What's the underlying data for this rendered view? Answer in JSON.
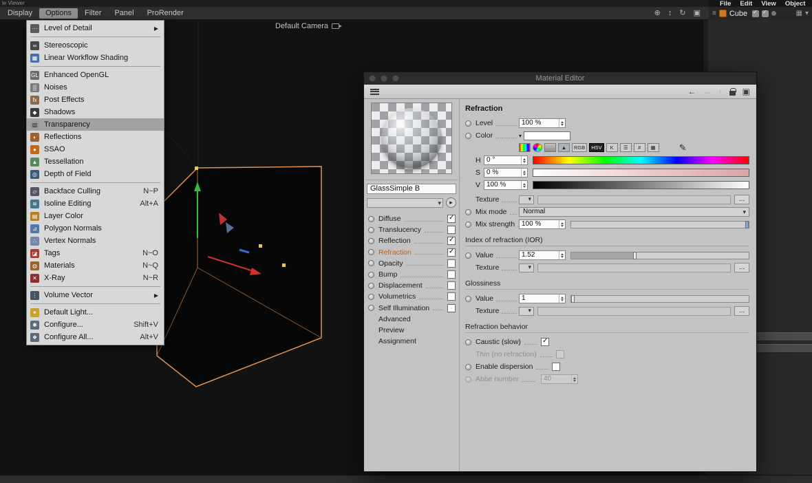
{
  "window": {
    "title_fragment": "le Viewer"
  },
  "top_right_menubar": {
    "items": [
      "File",
      "Edit",
      "View",
      "Object"
    ]
  },
  "viewport_menubar": {
    "items": [
      {
        "label": "Display"
      },
      {
        "label": "Options",
        "active": true
      },
      {
        "label": "Filter"
      },
      {
        "label": "Panel"
      },
      {
        "label": "ProRender"
      }
    ],
    "nav_icons": [
      {
        "name": "pan-icon",
        "glyph": "⊕"
      },
      {
        "name": "dolly-icon",
        "glyph": "↕"
      },
      {
        "name": "rotate-icon",
        "glyph": "↻"
      },
      {
        "name": "toggle-view-icon",
        "glyph": "▣"
      }
    ]
  },
  "viewport": {
    "camera_label": "Default Camera"
  },
  "object_manager": {
    "object_name": "Cube"
  },
  "options_menu": {
    "items": [
      {
        "label": "Level of Detail",
        "icon": "level-of-detail",
        "submenu": true
      },
      {
        "separator": true
      },
      {
        "label": "Stereoscopic",
        "icon": "stereoscopic"
      },
      {
        "label": "Linear Workflow Shading",
        "icon": "linear-workflow"
      },
      {
        "separator": true
      },
      {
        "label": "Enhanced OpenGL",
        "icon": "enhanced-opengl"
      },
      {
        "label": "Noises",
        "icon": "noises"
      },
      {
        "label": "Post Effects",
        "icon": "post-effects"
      },
      {
        "label": "Shadows",
        "icon": "shadows"
      },
      {
        "label": "Transparency",
        "icon": "transparency",
        "highlighted": true
      },
      {
        "label": "Reflections",
        "icon": "reflections"
      },
      {
        "label": "SSAO",
        "icon": "ssao"
      },
      {
        "label": "Tessellation",
        "icon": "tessellation"
      },
      {
        "label": "Depth of Field",
        "icon": "depth-of-field"
      },
      {
        "separator": true
      },
      {
        "label": "Backface Culling",
        "icon": "backface-culling",
        "shortcut": "N~P"
      },
      {
        "label": "Isoline Editing",
        "icon": "isoline-editing",
        "shortcut": "Alt+A"
      },
      {
        "label": "Layer Color",
        "icon": "layer-color"
      },
      {
        "label": "Polygon Normals",
        "icon": "polygon-normals"
      },
      {
        "label": "Vertex Normals",
        "icon": "vertex-normals"
      },
      {
        "label": "Tags",
        "icon": "tags",
        "shortcut": "N~O"
      },
      {
        "label": "Materials",
        "icon": "materials",
        "shortcut": "N~Q"
      },
      {
        "label": "X-Ray",
        "icon": "x-ray",
        "shortcut": "N~R"
      },
      {
        "separator": true
      },
      {
        "label": "Volume Vector",
        "icon": "volume-vector",
        "submenu": true
      },
      {
        "separator": true
      },
      {
        "label": "Default Light...",
        "icon": "default-light"
      },
      {
        "label": "Configure...",
        "icon": "configure",
        "shortcut": "Shift+V"
      },
      {
        "label": "Configure All...",
        "icon": "configure-all",
        "shortcut": "Alt+V"
      }
    ]
  },
  "icon_glyphs": {
    "level-of-detail": {
      "bg": "#5a5a5a",
      "glyph": "⋯"
    },
    "stereoscopic": {
      "bg": "#474747",
      "glyph": "∞"
    },
    "linear-workflow": {
      "bg": "#4a6fa5",
      "glyph": "▦"
    },
    "enhanced-opengl": {
      "bg": "#6a6a6a",
      "glyph": "GL"
    },
    "noises": {
      "bg": "#7a7a7a",
      "glyph": "▒"
    },
    "post-effects": {
      "bg": "#8a6a4a",
      "glyph": "fx"
    },
    "shadows": {
      "bg": "#3a3a3a",
      "glyph": "◆"
    },
    "transparency": {
      "bg": "#9a9a9a",
      "glyph": "▨",
      "fg": "#2a2a2a"
    },
    "reflections": {
      "bg": "#a06030",
      "glyph": "◐"
    },
    "ssao": {
      "bg": "#c06818",
      "glyph": "●"
    },
    "tessellation": {
      "bg": "#5a8a5a",
      "glyph": "▲"
    },
    "depth-of-field": {
      "bg": "#3a5a7a",
      "glyph": "◎"
    },
    "backface-culling": {
      "bg": "#555566",
      "glyph": "▱"
    },
    "isoline-editing": {
      "bg": "#46748c",
      "glyph": "≋"
    },
    "layer-color": {
      "bg": "#b08030",
      "glyph": "▤"
    },
    "polygon-normals": {
      "bg": "#5578aa",
      "glyph": "⊿"
    },
    "vertex-normals": {
      "bg": "#7788aa",
      "glyph": "∴"
    },
    "tags": {
      "bg": "#a04030",
      "glyph": "◪"
    },
    "materials": {
      "bg": "#96642c",
      "glyph": "◍"
    },
    "x-ray": {
      "bg": "#883030",
      "glyph": "✕"
    },
    "volume-vector": {
      "bg": "#445566",
      "glyph": "⋮"
    },
    "default-light": {
      "bg": "#c8a030",
      "glyph": "✶"
    },
    "configure": {
      "bg": "#5a6a7a",
      "glyph": "✱"
    },
    "configure-all": {
      "bg": "#5a6a7a",
      "glyph": "❖"
    },
    "eyedropper": {
      "glyph": "✎"
    }
  },
  "material_editor": {
    "title": "Material Editor",
    "toolbar": {
      "back_glyph": "←",
      "forward_glyph": "→",
      "up_glyph": "↑"
    },
    "material_name": "GlassSimple B",
    "channels": [
      {
        "label": "Diffuse",
        "checked": true
      },
      {
        "label": "Translucency",
        "checked": false
      },
      {
        "label": "Reflection",
        "checked": true
      },
      {
        "label": "Refraction",
        "checked": true,
        "active": true
      },
      {
        "label": "Opacity",
        "checked": false
      },
      {
        "label": "Bump",
        "checked": false
      },
      {
        "label": "Displacement",
        "checked": false
      },
      {
        "label": "Volumetrics",
        "checked": false
      },
      {
        "label": "Self Illumination",
        "checked": false
      }
    ],
    "pages": [
      "Advanced",
      "Preview",
      "Assignment"
    ],
    "refraction": {
      "heading": "Refraction",
      "level_label": "Level",
      "level_value": "100 %",
      "color_label": "Color",
      "picker_chips": [
        {
          "name": "spectrum-icon"
        },
        {
          "name": "color-wheel-icon"
        },
        {
          "name": "grayscale-icon"
        },
        {
          "name": "image-icon",
          "glyph": "▲"
        },
        {
          "name": "rgb-mode",
          "label": "RGB"
        },
        {
          "name": "hsv-mode",
          "label": "HSV",
          "active": true
        },
        {
          "name": "kelvin-mode",
          "label": "K"
        },
        {
          "name": "mixer-icon",
          "glyph": "☰"
        },
        {
          "name": "numeric-icon",
          "glyph": "#"
        },
        {
          "name": "table-icon",
          "glyph": "▦"
        }
      ],
      "h_label": "H",
      "h_value": "0 °",
      "s_label": "S",
      "s_value": "0 %",
      "v_label": "V",
      "v_value": "100 %",
      "texture_label": "Texture",
      "texture_button": "...",
      "mix_mode_label": "Mix mode",
      "mix_mode_value": "Normal",
      "mix_strength_label": "Mix strength",
      "mix_strength_value": "100 %",
      "ior_heading": "Index of refraction (IOR)",
      "ior_value_label": "Value",
      "ior_value": "1.52",
      "ior_texture_label": "Texture",
      "ior_texture_button": "...",
      "gloss_heading": "Glossiness",
      "gloss_value_label": "Value",
      "gloss_value": "1",
      "gloss_texture_label": "Texture",
      "gloss_texture_button": "...",
      "behavior_heading": "Refraction behavior",
      "caustic_label": "Caustic (slow)",
      "caustic_checked": true,
      "thin_label": "Thin (no refraction)",
      "thin_checked": false,
      "dispersion_label": "Enable dispersion",
      "dispersion_checked": false,
      "abbe_label": "Abbe number",
      "abbe_value": "40"
    }
  },
  "colors": {
    "cube_outline": "#df9356",
    "menu_highlight": "#a2a2a2",
    "active_channel_text": "#c05f10"
  }
}
